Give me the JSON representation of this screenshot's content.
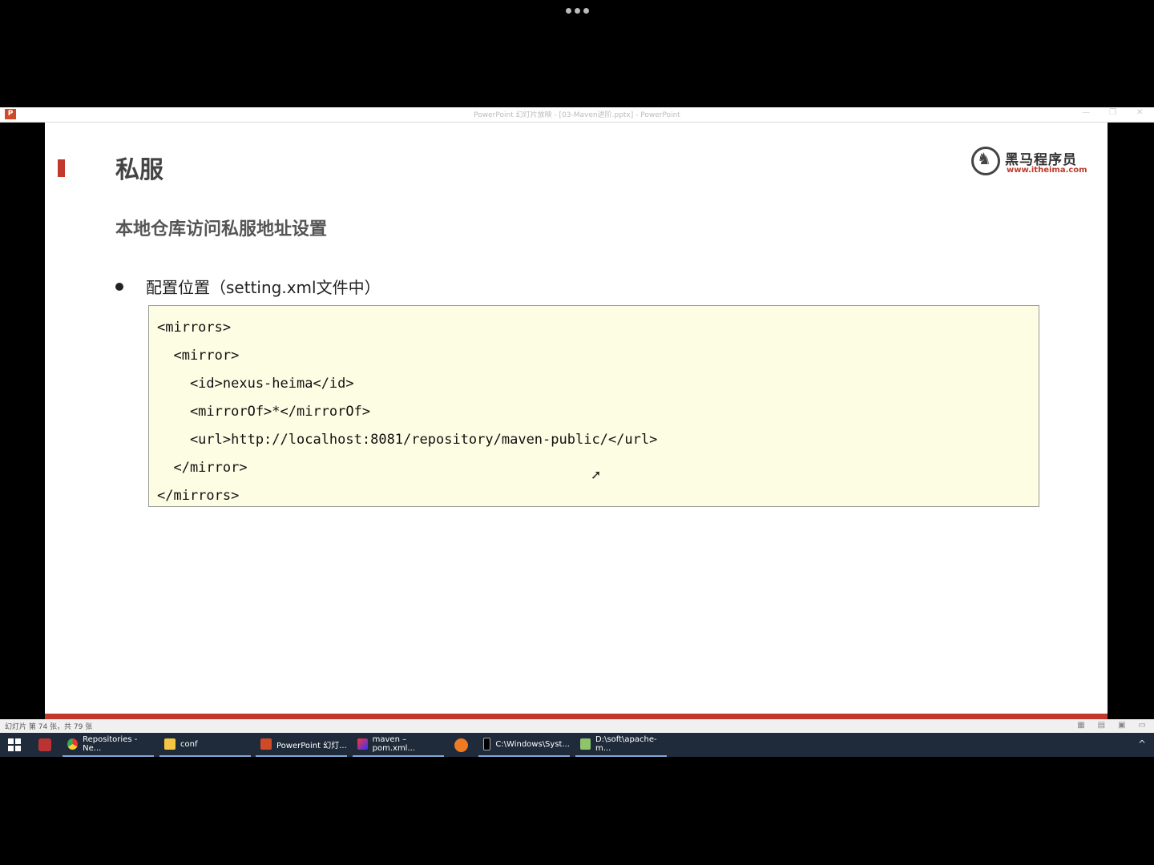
{
  "window": {
    "title": "PowerPoint 幻灯片放映 - [03-Maven进阶.pptx] - PowerPoint",
    "app_icon": "P",
    "controls": [
      "—",
      "❐",
      "✕"
    ]
  },
  "slide": {
    "title": "私服",
    "logo": {
      "name": "黑马程序员",
      "url": "www.itheima.com"
    },
    "subtitle": "本地仓库访问私服地址设置",
    "bullet": "配置位置（setting.xml文件中）",
    "code": [
      "<mirrors>",
      "  <mirror>",
      "    <id>nexus-heima</id>",
      "    <mirrorOf>*</mirrorOf>",
      "    <url>http://localhost:8081/repository/maven-public/</url>",
      "  </mirror>",
      "</mirrors>"
    ]
  },
  "statusbar": {
    "slide_counter": "幻灯片 第 74 张，共 79 张"
  },
  "taskbar": {
    "items": [
      {
        "label": "Repositories - Ne...",
        "icon": "chrome-icon"
      },
      {
        "label": "conf",
        "icon": "folder-icon"
      },
      {
        "label": "PowerPoint 幻灯...",
        "icon": "powerpoint-icon"
      },
      {
        "label": "maven – pom.xml...",
        "icon": "intellij-icon"
      },
      {
        "label": "C:\\Windows\\Syst...",
        "icon": "cmd-icon"
      },
      {
        "label": "D:\\soft\\apache-m...",
        "icon": "notepad-icon"
      }
    ]
  },
  "colors": {
    "accent_red": "#c0392b",
    "code_bg": "#fdfde4",
    "taskbar_bg": "#1f2b3a"
  }
}
